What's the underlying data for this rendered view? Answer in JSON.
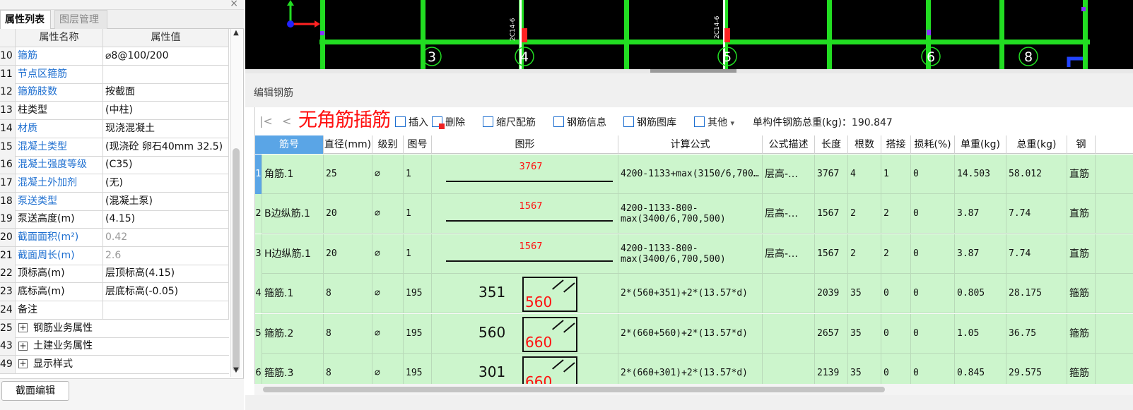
{
  "left_panel": {
    "tabs": [
      "属性列表",
      "图层管理"
    ],
    "header": {
      "name": "属性名称",
      "value": "属性值"
    },
    "rows": [
      {
        "num": "10",
        "name": "箍筋",
        "value": "⌀8@100/200",
        "blue": true
      },
      {
        "num": "11",
        "name": "节点区箍筋",
        "value": "",
        "blue": true
      },
      {
        "num": "12",
        "name": "箍筋肢数",
        "value": "按截面",
        "blue": true
      },
      {
        "num": "13",
        "name": "柱类型",
        "value": "(中柱)",
        "blue": false
      },
      {
        "num": "14",
        "name": "材质",
        "value": "现浇混凝土",
        "blue": true
      },
      {
        "num": "15",
        "name": "混凝土类型",
        "value": "(现浇砼 卵石40mm 32.5)",
        "blue": true
      },
      {
        "num": "16",
        "name": "混凝土强度等级",
        "value": "(C35)",
        "blue": true
      },
      {
        "num": "17",
        "name": "混凝土外加剂",
        "value": "(无)",
        "blue": true
      },
      {
        "num": "18",
        "name": "泵送类型",
        "value": "(混凝土泵)",
        "blue": true
      },
      {
        "num": "19",
        "name": "泵送高度(m)",
        "value": "(4.15)",
        "blue": false
      },
      {
        "num": "20",
        "name": "截面面积(m²)",
        "value": "0.42",
        "blue": true,
        "gray_value": true
      },
      {
        "num": "21",
        "name": "截面周长(m)",
        "value": "2.6",
        "blue": true,
        "gray_value": true
      },
      {
        "num": "22",
        "name": "顶标高(m)",
        "value": "层顶标高(4.15)",
        "blue": false
      },
      {
        "num": "23",
        "name": "底标高(m)",
        "value": "层底标高(-0.05)",
        "blue": false
      },
      {
        "num": "24",
        "name": "备注",
        "value": "",
        "blue": false
      },
      {
        "num": "25",
        "name": "钢筋业务属性",
        "value": "",
        "expander": true
      },
      {
        "num": "43",
        "name": "土建业务属性",
        "value": "",
        "expander": true
      },
      {
        "num": "49",
        "name": "显示样式",
        "value": "",
        "expander": true
      }
    ],
    "section_edit_button": "截面编辑"
  },
  "cad": {
    "axis_labels": [
      "3",
      "4",
      "5",
      "6",
      "8"
    ],
    "rebar_tags": [
      "2C14-6",
      "2C14-6"
    ]
  },
  "edit_panel": {
    "title": "编辑钢筋",
    "overlay_text": "无角筋插筋",
    "toolbar": {
      "first": "|<",
      "prev": "<",
      "insert": "插入",
      "delete": "删除",
      "scale": "缩尺配筋",
      "info": "钢筋信息",
      "library": "钢筋图库",
      "other": "其他",
      "other_arrow": "▾",
      "total_weight_label": "单构件钢筋总重(kg)：190.847"
    }
  },
  "rebar_table": {
    "columns": [
      "筋号",
      "直径(mm)",
      "级别",
      "图号",
      "图形",
      "计算公式",
      "公式描述",
      "长度",
      "根数",
      "搭接",
      "损耗(%)",
      "单重(kg)",
      "总重(kg)",
      "钢"
    ],
    "rows": [
      {
        "rn": "1",
        "name": "角筋.1",
        "dia": "25",
        "grade": "⌀",
        "fig": "1",
        "shape": {
          "type": "line",
          "label": "3767"
        },
        "formula": "4200-1133+max(3150/6,700…",
        "desc": "层高-…",
        "len": "3767",
        "count": "4",
        "lap": "1",
        "loss": "0",
        "unit": "14.503",
        "total": "58.012",
        "tail": "直筋"
      },
      {
        "rn": "2",
        "name": "B边纵筋.1",
        "dia": "20",
        "grade": "⌀",
        "fig": "1",
        "shape": {
          "type": "line",
          "label": "1567"
        },
        "formula": "4200-1133-800-max(3400/6,700,500)",
        "desc": "层高-…",
        "len": "1567",
        "count": "2",
        "lap": "2",
        "loss": "0",
        "unit": "3.87",
        "total": "7.74",
        "tail": "直筋"
      },
      {
        "rn": "3",
        "name": "H边纵筋.1",
        "dia": "20",
        "grade": "⌀",
        "fig": "1",
        "shape": {
          "type": "line",
          "label": "1567"
        },
        "formula": "4200-1133-800-max(3400/6,700,500)",
        "desc": "层高-…",
        "len": "1567",
        "count": "2",
        "lap": "2",
        "loss": "0",
        "unit": "3.87",
        "total": "7.74",
        "tail": "直筋"
      },
      {
        "rn": "4",
        "name": "箍筋.1",
        "dia": "8",
        "grade": "⌀",
        "fig": "195",
        "shape": {
          "type": "stirrup",
          "a": "351",
          "b": "560"
        },
        "formula": "2*(560+351)+2*(13.57*d)",
        "desc": "",
        "len": "2039",
        "count": "35",
        "lap": "0",
        "loss": "0",
        "unit": "0.805",
        "total": "28.175",
        "tail": "箍筋"
      },
      {
        "rn": "5",
        "name": "箍筋.2",
        "dia": "8",
        "grade": "⌀",
        "fig": "195",
        "shape": {
          "type": "stirrup",
          "a": "560",
          "b": "660"
        },
        "formula": "2*(660+560)+2*(13.57*d)",
        "desc": "",
        "len": "2657",
        "count": "35",
        "lap": "0",
        "loss": "0",
        "unit": "1.05",
        "total": "36.75",
        "tail": "箍筋"
      },
      {
        "rn": "6",
        "name": "箍筋.3",
        "dia": "8",
        "grade": "⌀",
        "fig": "195",
        "shape": {
          "type": "stirrup",
          "a": "301",
          "b": "660"
        },
        "formula": "2*(660+301)+2*(13.57*d)",
        "desc": "",
        "len": "2139",
        "count": "35",
        "lap": "0",
        "loss": "0",
        "unit": "0.845",
        "total": "29.575",
        "tail": "箍筋"
      }
    ]
  },
  "colors": {
    "cad_bg": "#000000",
    "cad_green": "#22dd22",
    "row_green": "#ccf5cc",
    "header_sel": "#5aa5e6",
    "blue_link": "#1e6fd0",
    "red": "#ff1111"
  }
}
